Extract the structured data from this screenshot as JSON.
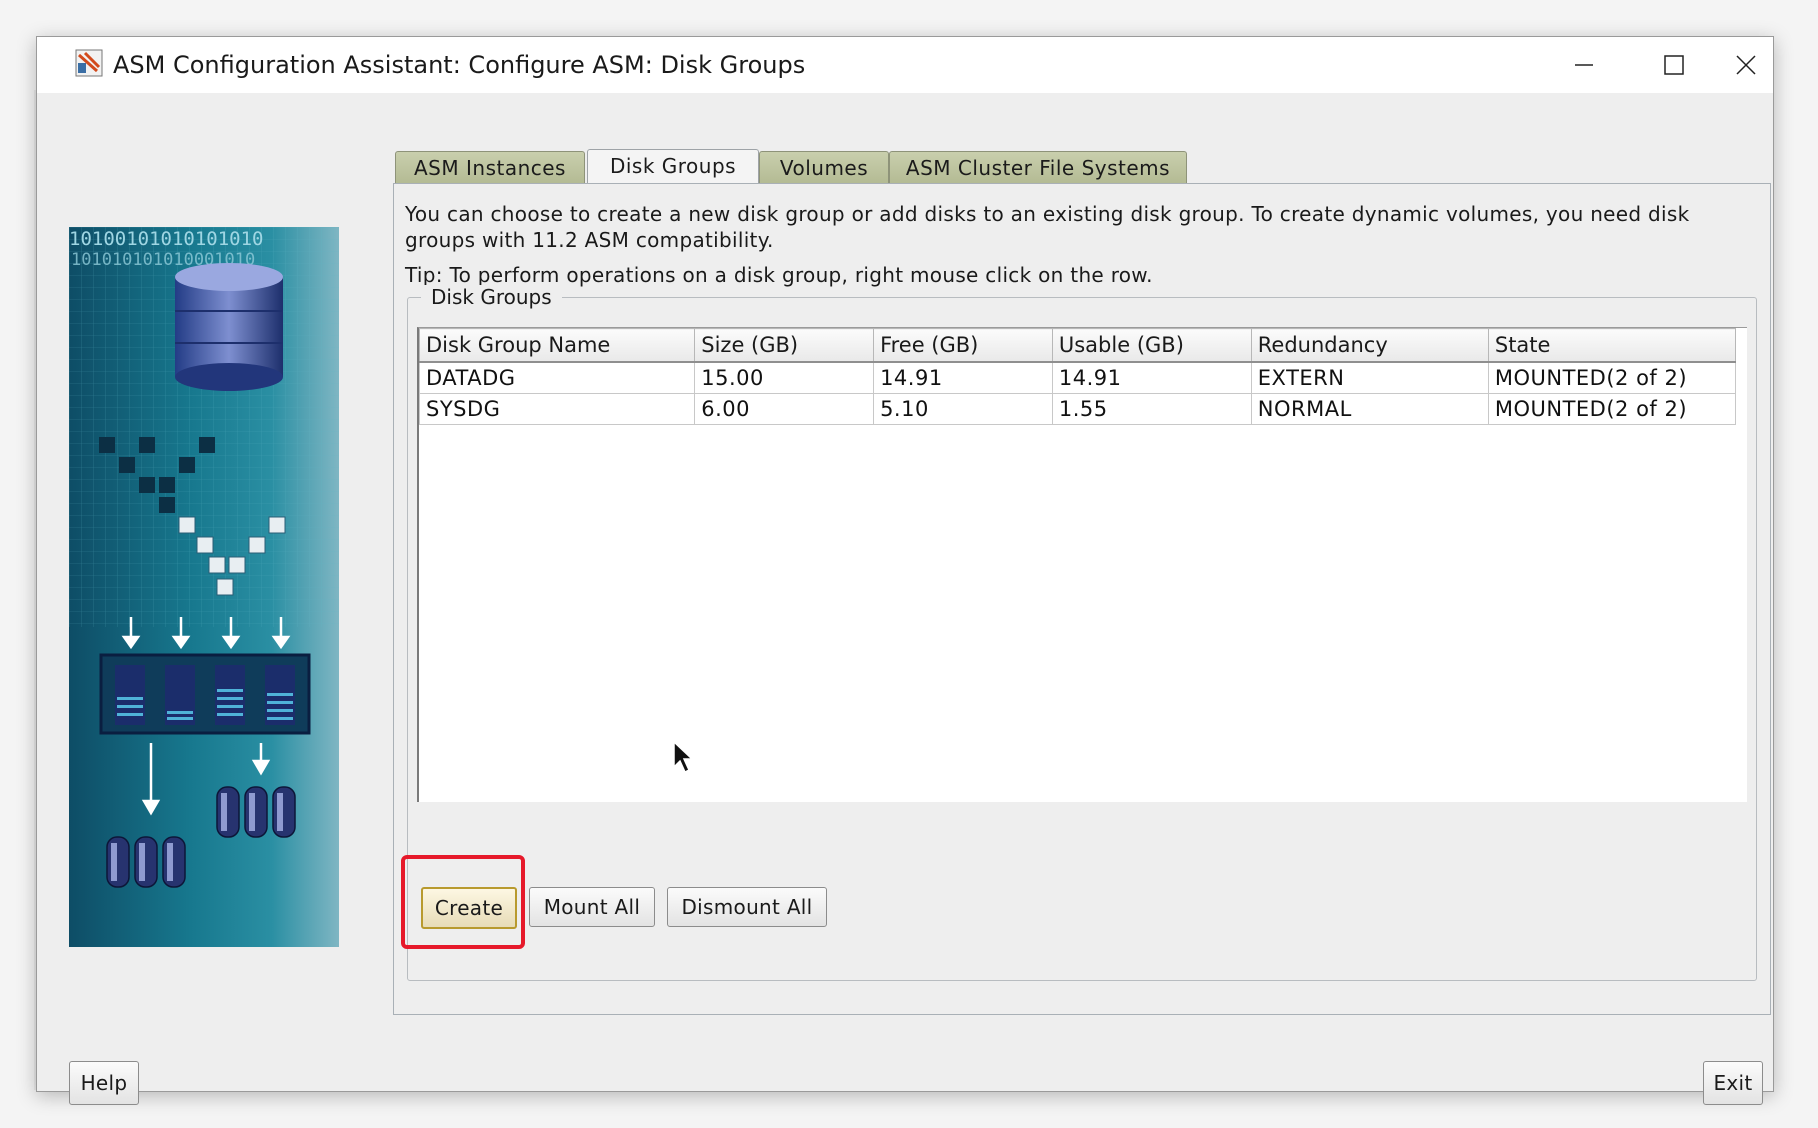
{
  "window": {
    "title": "ASM Configuration Assistant: Configure ASM: Disk Groups"
  },
  "tabs": [
    {
      "label": "ASM Instances",
      "active": false
    },
    {
      "label": "Disk Groups",
      "active": true
    },
    {
      "label": "Volumes",
      "active": false
    },
    {
      "label": "ASM Cluster File Systems",
      "active": false
    }
  ],
  "panel": {
    "description": "You can choose to create a new disk group or add disks to an existing disk group. To create dynamic volumes, you need disk groups with 11.2 ASM compatibility.",
    "tip": "Tip: To perform operations on a disk group, right mouse click on the row.",
    "group_title": "Disk Groups"
  },
  "table": {
    "columns": [
      "Disk Group Name",
      "Size (GB)",
      "Free (GB)",
      "Usable (GB)",
      "Redundancy",
      "State"
    ],
    "rows": [
      [
        "DATADG",
        "15.00",
        "14.91",
        "14.91",
        "EXTERN",
        "MOUNTED(2 of 2)"
      ],
      [
        "SYSDG",
        "6.00",
        "5.10",
        "1.55",
        "NORMAL",
        "MOUNTED(2 of 2)"
      ]
    ]
  },
  "buttons": {
    "create": "Create",
    "mount_all": "Mount All",
    "dismount_all": "Dismount All",
    "help": "Help",
    "exit": "Exit"
  },
  "illustration": {
    "binary_line_1": "10100101010101010",
    "binary_line_2": "101010101010001010"
  },
  "colors": {
    "highlight": "#e6192a",
    "tab_inactive": "#b3ba93",
    "illustration": "#17788e"
  }
}
